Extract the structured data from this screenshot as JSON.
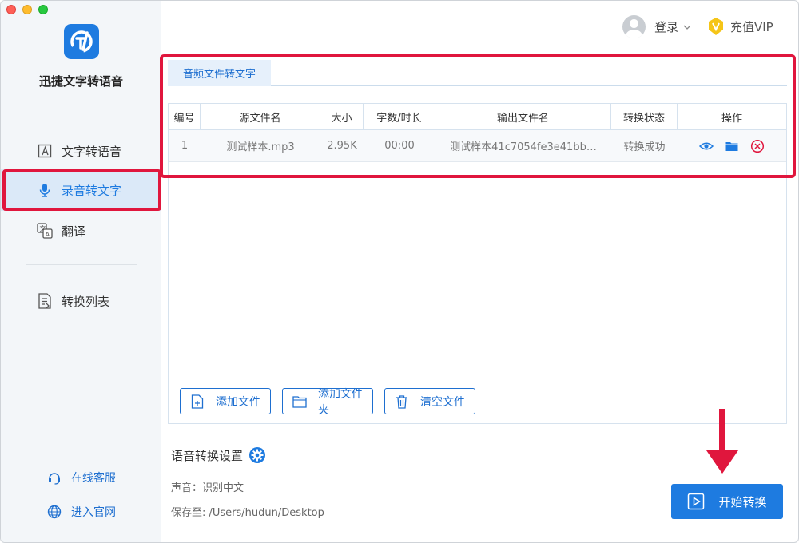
{
  "app": {
    "name": "迅捷文字转语音"
  },
  "sidebar": {
    "items": [
      {
        "label": "文字转语音",
        "icon": "text-a-icon"
      },
      {
        "label": "录音转文字",
        "icon": "microphone-icon",
        "active": true
      },
      {
        "label": "翻译",
        "icon": "translate-icon"
      },
      {
        "label": "转换列表",
        "icon": "list-document-icon"
      }
    ],
    "bottom_links": [
      {
        "label": "在线客服",
        "icon": "headset-icon"
      },
      {
        "label": "进入官网",
        "icon": "globe-icon"
      }
    ]
  },
  "header": {
    "login_label": "登录",
    "vip_label": "充值VIP"
  },
  "tabs": [
    {
      "label": "音频文件转文字",
      "active": true
    }
  ],
  "table": {
    "columns": [
      "编号",
      "源文件名",
      "大小",
      "字数/时长",
      "输出文件名",
      "转换状态",
      "操作"
    ],
    "rows": [
      {
        "index": "1",
        "source": "测试样本.mp3",
        "size": "2.95K",
        "duration": "00:00",
        "output": "测试样本41c7054fe3e41bb…",
        "status": "转换成功"
      }
    ],
    "row_actions": [
      "eye-icon",
      "folder-icon",
      "delete-circle-icon"
    ]
  },
  "actions": {
    "add_file": "添加文件",
    "add_folder": "添加文件夹",
    "clear_files": "清空文件"
  },
  "settings": {
    "title": "语音转换设置",
    "voice_line": "声音：识别中文",
    "save_line": "保存至: /Users/hudun/Desktop"
  },
  "start_button": "开始转换",
  "colors": {
    "accent": "#1e7be0",
    "highlight": "#e0163d",
    "vip": "#f5c518"
  }
}
